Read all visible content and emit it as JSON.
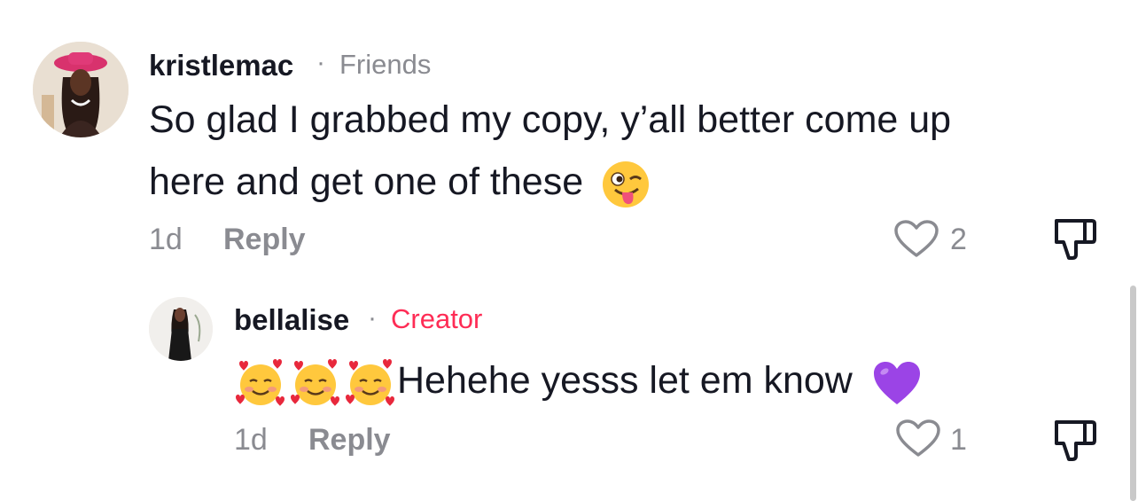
{
  "comments": [
    {
      "username": "kristlemac",
      "tag": "Friends",
      "text_line1": "So glad I grabbed my copy, y’all better come up",
      "text_line2": "here and get one of these",
      "emoji": "winking-tongue-face",
      "time": "1d",
      "reply_label": "Reply",
      "likes": "2"
    },
    {
      "username": "bellalise",
      "tag": "Creator",
      "text": "Hehehe yesss let em know",
      "emojis_before": [
        "smiling-face-with-hearts",
        "smiling-face-with-hearts",
        "smiling-face-with-hearts"
      ],
      "emoji_after": "purple-heart",
      "time": "1d",
      "reply_label": "Reply",
      "likes": "1"
    }
  ],
  "colors": {
    "creator_tag": "#fe2c55",
    "muted": "#8a8b91",
    "text": "#161823"
  },
  "separator": "·"
}
